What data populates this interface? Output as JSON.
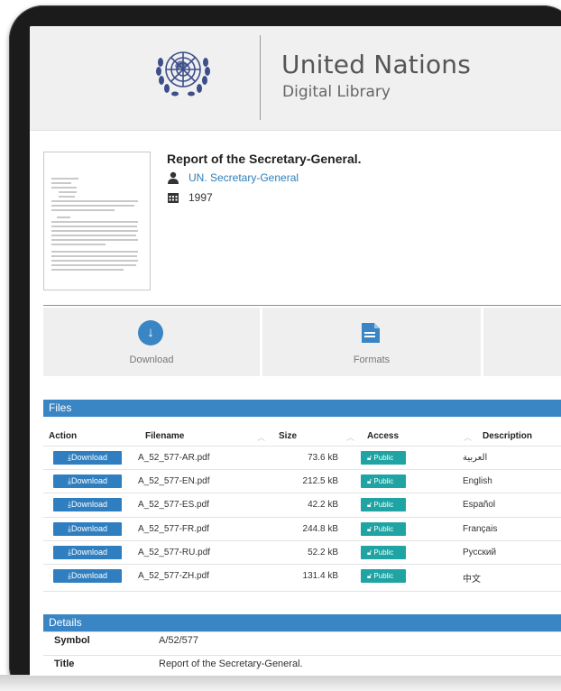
{
  "header": {
    "org_title": "United Nations",
    "org_subtitle": "Digital Library",
    "emblem_icon": "un-emblem-icon"
  },
  "record": {
    "title": "Report of the Secretary-General.",
    "author": "UN. Secretary-General",
    "year": "1997",
    "author_icon": "person-icon",
    "year_icon": "calendar-icon"
  },
  "tiles": {
    "download_label": "Download",
    "formats_label": "Formats"
  },
  "files": {
    "section_title": "Files",
    "columns": [
      "Action",
      "Filename",
      "Size",
      "Access",
      "Description"
    ],
    "rows": [
      {
        "button": "Download",
        "filename": "A_52_577-AR.pdf",
        "size": "73.6 kB",
        "access": "Public",
        "description": "العربية"
      },
      {
        "button": "Download",
        "filename": "A_52_577-EN.pdf",
        "size": "212.5 kB",
        "access": "Public",
        "description": "English"
      },
      {
        "button": "Download",
        "filename": "A_52_577-ES.pdf",
        "size": "42.2 kB",
        "access": "Public",
        "description": "Español"
      },
      {
        "button": "Download",
        "filename": "A_52_577-FR.pdf",
        "size": "244.8 kB",
        "access": "Public",
        "description": "Français"
      },
      {
        "button": "Download",
        "filename": "A_52_577-RU.pdf",
        "size": "52.2 kB",
        "access": "Public",
        "description": "Русский"
      },
      {
        "button": "Download",
        "filename": "A_52_577-ZH.pdf",
        "size": "131.4 kB",
        "access": "Public",
        "description": "中文"
      }
    ]
  },
  "details": {
    "section_title": "Details",
    "rows": [
      {
        "key": "Symbol",
        "value": "A/52/577"
      },
      {
        "key": "Title",
        "value": "Report of the Secretary-General."
      }
    ]
  },
  "colors": {
    "accent": "#3a86c4",
    "link": "#2d7fb9",
    "public_badge": "#1fa3a3"
  }
}
